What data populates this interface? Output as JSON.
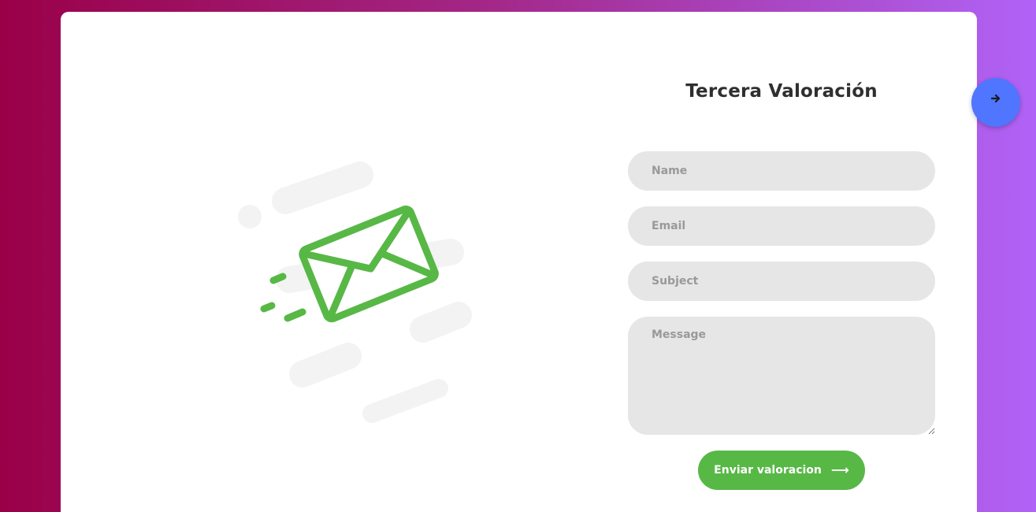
{
  "form": {
    "title": "Tercera Valoración",
    "name_placeholder": "Name",
    "email_placeholder": "Email",
    "subject_placeholder": "Subject",
    "message_placeholder": "Message",
    "submit_label": "Enviar valoracion",
    "submit_icon": "long-arrow-right-icon"
  },
  "nav": {
    "next_icon": "arrow-right-icon"
  },
  "illustration": {
    "icon": "envelope-icon"
  },
  "colors": {
    "accent": "#57b846",
    "field_bg": "#e6e6e6",
    "next_button": "#5075ff",
    "gradient_start": "#9a0048",
    "gradient_end": "#b063f7"
  }
}
